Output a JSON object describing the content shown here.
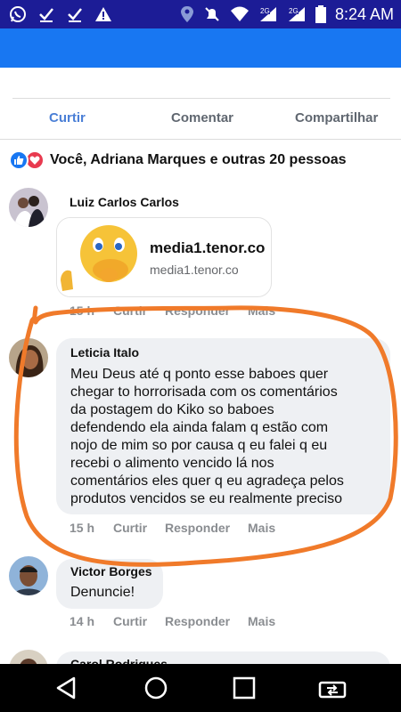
{
  "status_bar": {
    "time": "8:24 AM",
    "icons_left": [
      "whatsapp-icon",
      "check-icon",
      "check-icon",
      "warning-icon"
    ],
    "icons_right": [
      "location-icon",
      "mute-icon",
      "wifi-icon",
      "signal-2g-icon",
      "signal-2g-icon",
      "battery-icon"
    ],
    "network_label_1": "2G",
    "network_label_2": "2G"
  },
  "colors": {
    "brand_blue": "#1877f2",
    "status_bar": "#1c1c96",
    "annotation_orange": "#f07a2a",
    "like_active": "#4a7fd6"
  },
  "actions": {
    "like": "Curtir",
    "comment": "Comentar",
    "share": "Compartilhar"
  },
  "reactions": {
    "summary": "Você, Adriana Marques e outras 20 pessoas"
  },
  "comments": [
    {
      "author": "Luiz Carlos Carlos",
      "link_title": "media1.tenor.co",
      "link_domain": "media1.tenor.co",
      "time": "15 h",
      "like": "Curtir",
      "reply": "Responder",
      "more": "Mais"
    },
    {
      "author": "Leticia Italo",
      "text_lines": [
        "Meu Deus até q ponto esse baboes quer",
        "chegar to horrorisada com os comentários",
        "da postagem do Kiko so baboes",
        "defendendo ela ainda falam q estão com",
        "nojo de mim so por causa q eu falei q eu",
        "recebi o alimento vencido lá nos",
        "comentários eles quer q eu agradeça pelos",
        "produtos vencidos se eu realmente preciso"
      ],
      "time": "15 h",
      "like": "Curtir",
      "reply": "Responder",
      "more": "Mais"
    },
    {
      "author": "Victor Borges",
      "text": "Denuncie!",
      "time": "14 h",
      "like": "Curtir",
      "reply": "Responder",
      "more": "Mais"
    },
    {
      "author": "Carol Rodrigues"
    }
  ],
  "nav": [
    "back-icon",
    "home-icon",
    "recents-icon",
    "screen-switch-icon"
  ]
}
